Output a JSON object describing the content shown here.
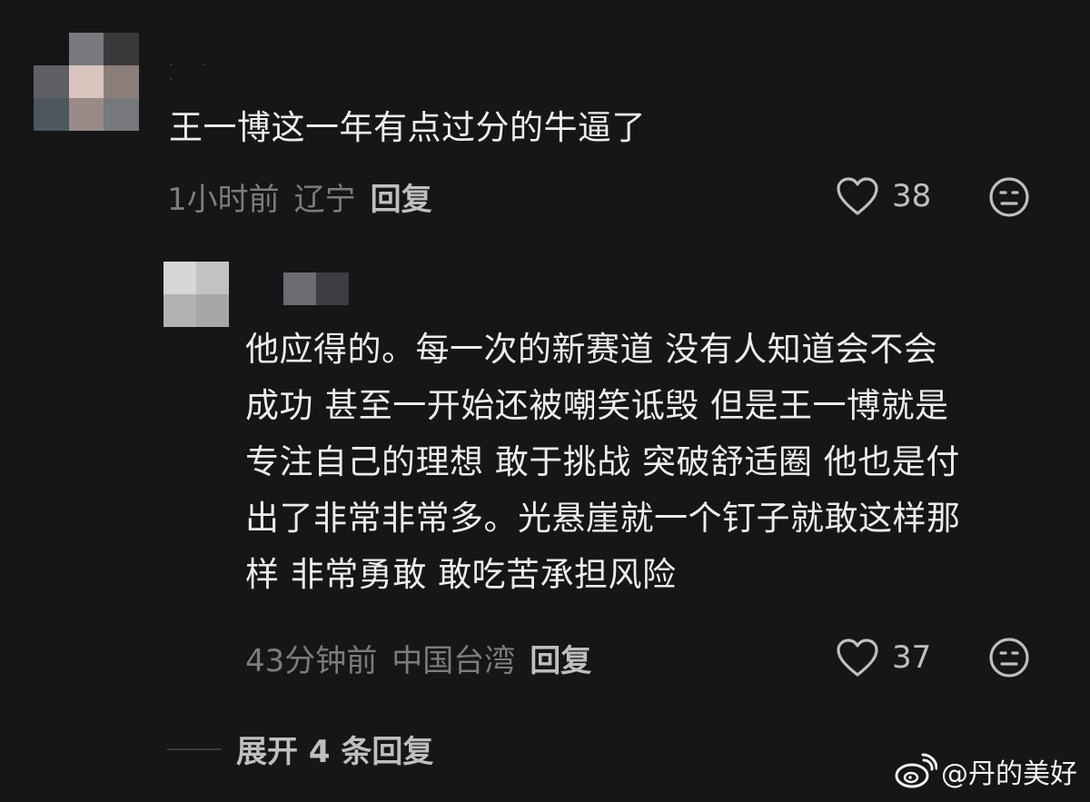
{
  "comment": {
    "text": "王一博这一年有点过分的牛逼了",
    "time": "1小时前",
    "location": "辽宁",
    "reply_label": "回复",
    "likes": "38",
    "avatar_pixels": [
      "#151517",
      "#7a7a7e",
      "#3a3a3d",
      "#5f5f63",
      "#d9c4bd",
      "#8c7e7b",
      "#4e5660",
      "#9a8a87",
      "#77787c"
    ]
  },
  "reply": {
    "lines": [
      "他应得的。每一次的新赛道 没有人知道会不会",
      "成功 甚至一开始还被嘲笑诋毁 但是王一博就是",
      "专注自己的理想 敢于挑战 突破舒适圈 他也是付",
      "出了非常非常多。光悬崖就一个钉子就敢这样那",
      "样 非常勇敢 敢吃苦承担风险"
    ],
    "time": "43分钟前",
    "location": "中国台湾",
    "reply_label": "回复",
    "likes": "37",
    "avatar_pixels": [
      "#d6d6d4",
      "#c2c2c0",
      "#b2b2b0",
      "#a7a7a5"
    ],
    "name_pixels": [
      "#161618",
      "#6a6c72",
      "#3c3d41",
      "#161618"
    ]
  },
  "expand_label": "展开 4 条回复",
  "watermark": {
    "text": "@丹的美好",
    "icon": "weibo-logo-icon"
  },
  "colors": {
    "background": "#161618",
    "text": "#ececee",
    "meta": "#7c7c80",
    "action": "#bfbfc2"
  }
}
